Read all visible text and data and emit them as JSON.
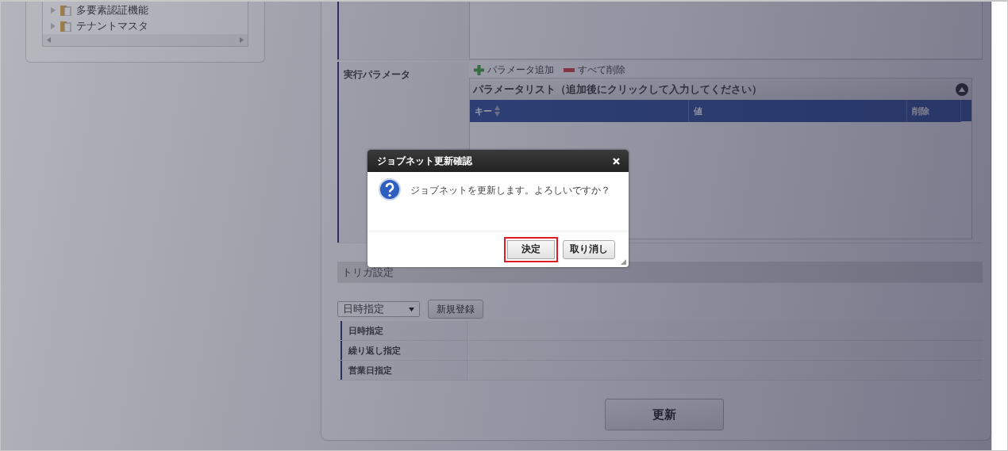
{
  "tree": {
    "items": [
      {
        "label": "多要素認証機能"
      },
      {
        "label": "テナントマスタ"
      }
    ]
  },
  "parameters": {
    "label": "実行パラメータ",
    "add": "パラメータ追加",
    "delete_all": "すべて削除",
    "list_title": "パラメータリスト（追加後にクリックして入力してください）",
    "columns": [
      "キー",
      "値",
      "削除"
    ]
  },
  "trigger": {
    "title": "トリガ設定",
    "select_value": "日時指定",
    "new_button": "新規登録",
    "rows": [
      "日時指定",
      "繰り返し指定",
      "営業日指定"
    ]
  },
  "update_button": "更新",
  "dialog": {
    "title": "ジョブネット更新確認",
    "message": "ジョブネットを更新します。よろしいですか？",
    "buttons": [
      {
        "label": "決定",
        "focused": true
      },
      {
        "label": "取り消し",
        "focused": false
      }
    ]
  }
}
